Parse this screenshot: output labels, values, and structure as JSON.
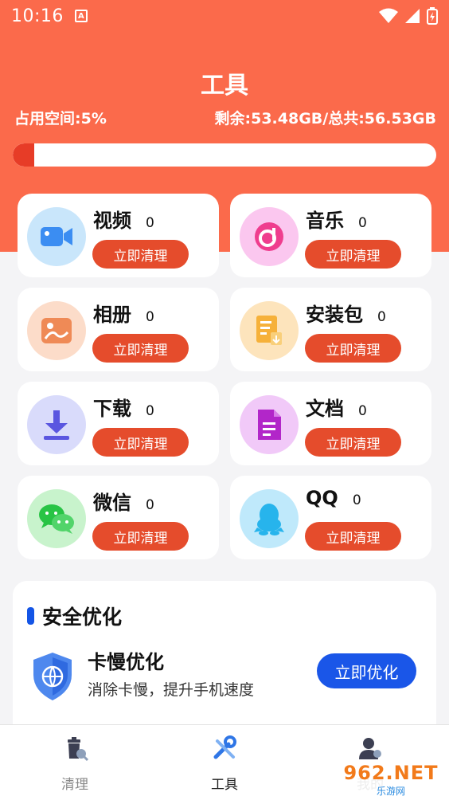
{
  "status": {
    "time": "10:16",
    "notif_letter": "A"
  },
  "header": {
    "title": "工具",
    "used_label": "占用空间:5%",
    "remaining_label": "剩余:53.48GB/总共:56.53GB",
    "usage_fraction": 0.05
  },
  "cards": [
    {
      "name": "视频",
      "count": "0",
      "button": "立即清理",
      "icon": "video-icon"
    },
    {
      "name": "音乐",
      "count": "0",
      "button": "立即清理",
      "icon": "music-icon"
    },
    {
      "name": "相册",
      "count": "0",
      "button": "立即清理",
      "icon": "album-icon"
    },
    {
      "name": "安装包",
      "count": "0",
      "button": "立即清理",
      "icon": "apk-icon"
    },
    {
      "name": "下载",
      "count": "0",
      "button": "立即清理",
      "icon": "download-icon"
    },
    {
      "name": "文档",
      "count": "0",
      "button": "立即清理",
      "icon": "document-icon"
    },
    {
      "name": "微信",
      "count": "0",
      "button": "立即清理",
      "icon": "wechat-icon"
    },
    {
      "name": "QQ",
      "count": "0",
      "button": "立即清理",
      "icon": "qq-icon"
    }
  ],
  "safety": {
    "section_title": "安全优化",
    "item_title": "卡慢优化",
    "item_subtitle": "消除卡慢，提升手机速度",
    "button": "立即优化"
  },
  "tabs": [
    {
      "label": "清理",
      "icon": "trash-icon",
      "active": false
    },
    {
      "label": "工具",
      "icon": "tools-icon",
      "active": true
    },
    {
      "label": "我的",
      "icon": "profile-icon",
      "active": false
    }
  ],
  "watermark": {
    "top": "962.NET",
    "bottom": "乐游网"
  },
  "colors": {
    "accent": "#fb6a4b",
    "button": "#e54c2c",
    "blue": "#1a56e8"
  }
}
